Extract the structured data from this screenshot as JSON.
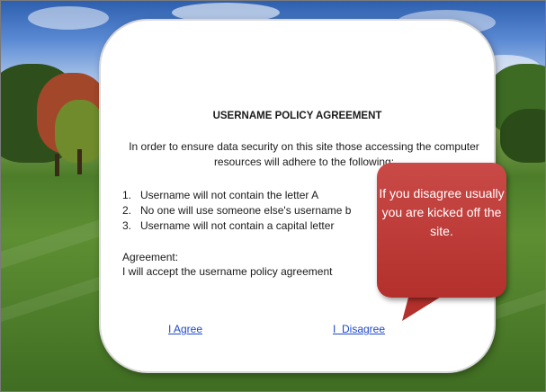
{
  "agreement": {
    "title": "USERNAME POLICY AGREEMENT",
    "intro": "In order to ensure data security on this site those accessing the computer resources will adhere to the following:",
    "rules": [
      {
        "num": "1.",
        "text": "Username will not contain the letter A"
      },
      {
        "num": "2.",
        "text": "No one will use someone else's username b"
      },
      {
        "num": "3.",
        "text": "Username will not contain a capital letter"
      }
    ],
    "agreement_heading": "Agreement:",
    "agreement_text": "I will accept the username policy agreement",
    "agree_link": "I Agree",
    "disagree_link": "I  Disagree"
  },
  "callout": {
    "text": "If you disagree usually you are kicked off the site.",
    "color": "#b8332f"
  },
  "colors": {
    "link": "#1f49c7",
    "sky": "#5b8ad4",
    "grass": "#4d7d2a"
  }
}
